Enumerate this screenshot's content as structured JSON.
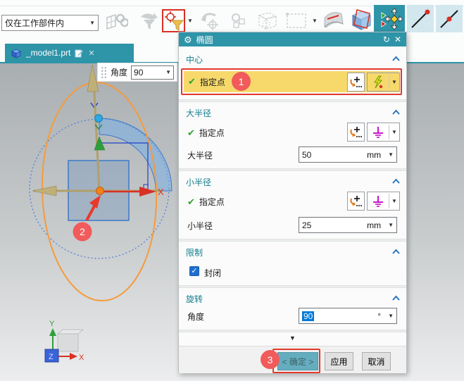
{
  "toolbar": {
    "scope_value": "仅在工作部件内"
  },
  "tab": {
    "title": "_model1.prt"
  },
  "canvas": {
    "angle_label": "角度",
    "angle_value": "90",
    "axis_x_label": "X",
    "triad": {
      "x": "X",
      "y": "Y",
      "z": "Z"
    }
  },
  "annotations": {
    "badge1": "1",
    "badge2": "2",
    "badge3": "3"
  },
  "dialog": {
    "title": "椭圆",
    "sections": {
      "center": {
        "label": "中心",
        "point_label": "指定点"
      },
      "major": {
        "label": "大半径",
        "point_label": "指定点",
        "radius_label": "大半径",
        "value": "50",
        "unit": "mm"
      },
      "minor": {
        "label": "小半径",
        "point_label": "指定点",
        "radius_label": "小半径",
        "value": "25",
        "unit": "mm"
      },
      "limits": {
        "label": "限制",
        "closed_label": "封闭"
      },
      "rotation": {
        "label": "旋转",
        "angle_label": "角度",
        "value": "90",
        "unit": "°"
      }
    },
    "buttons": {
      "ok": "< 确定 >",
      "apply": "应用",
      "cancel": "取消"
    }
  },
  "icons": {
    "gear": "⚙",
    "reset": "↻",
    "close": "✕",
    "tab_close": "✕",
    "caret": "▼",
    "check": "✔",
    "checkbox_check": "✓",
    "more": "▼"
  },
  "colors": {
    "accent_teal": "#2e94a8",
    "highlight_yellow": "#f7d96b",
    "annotation_red": "#e23a2e",
    "selection_blue": "#0078d7",
    "section_text": "#127e8e"
  }
}
